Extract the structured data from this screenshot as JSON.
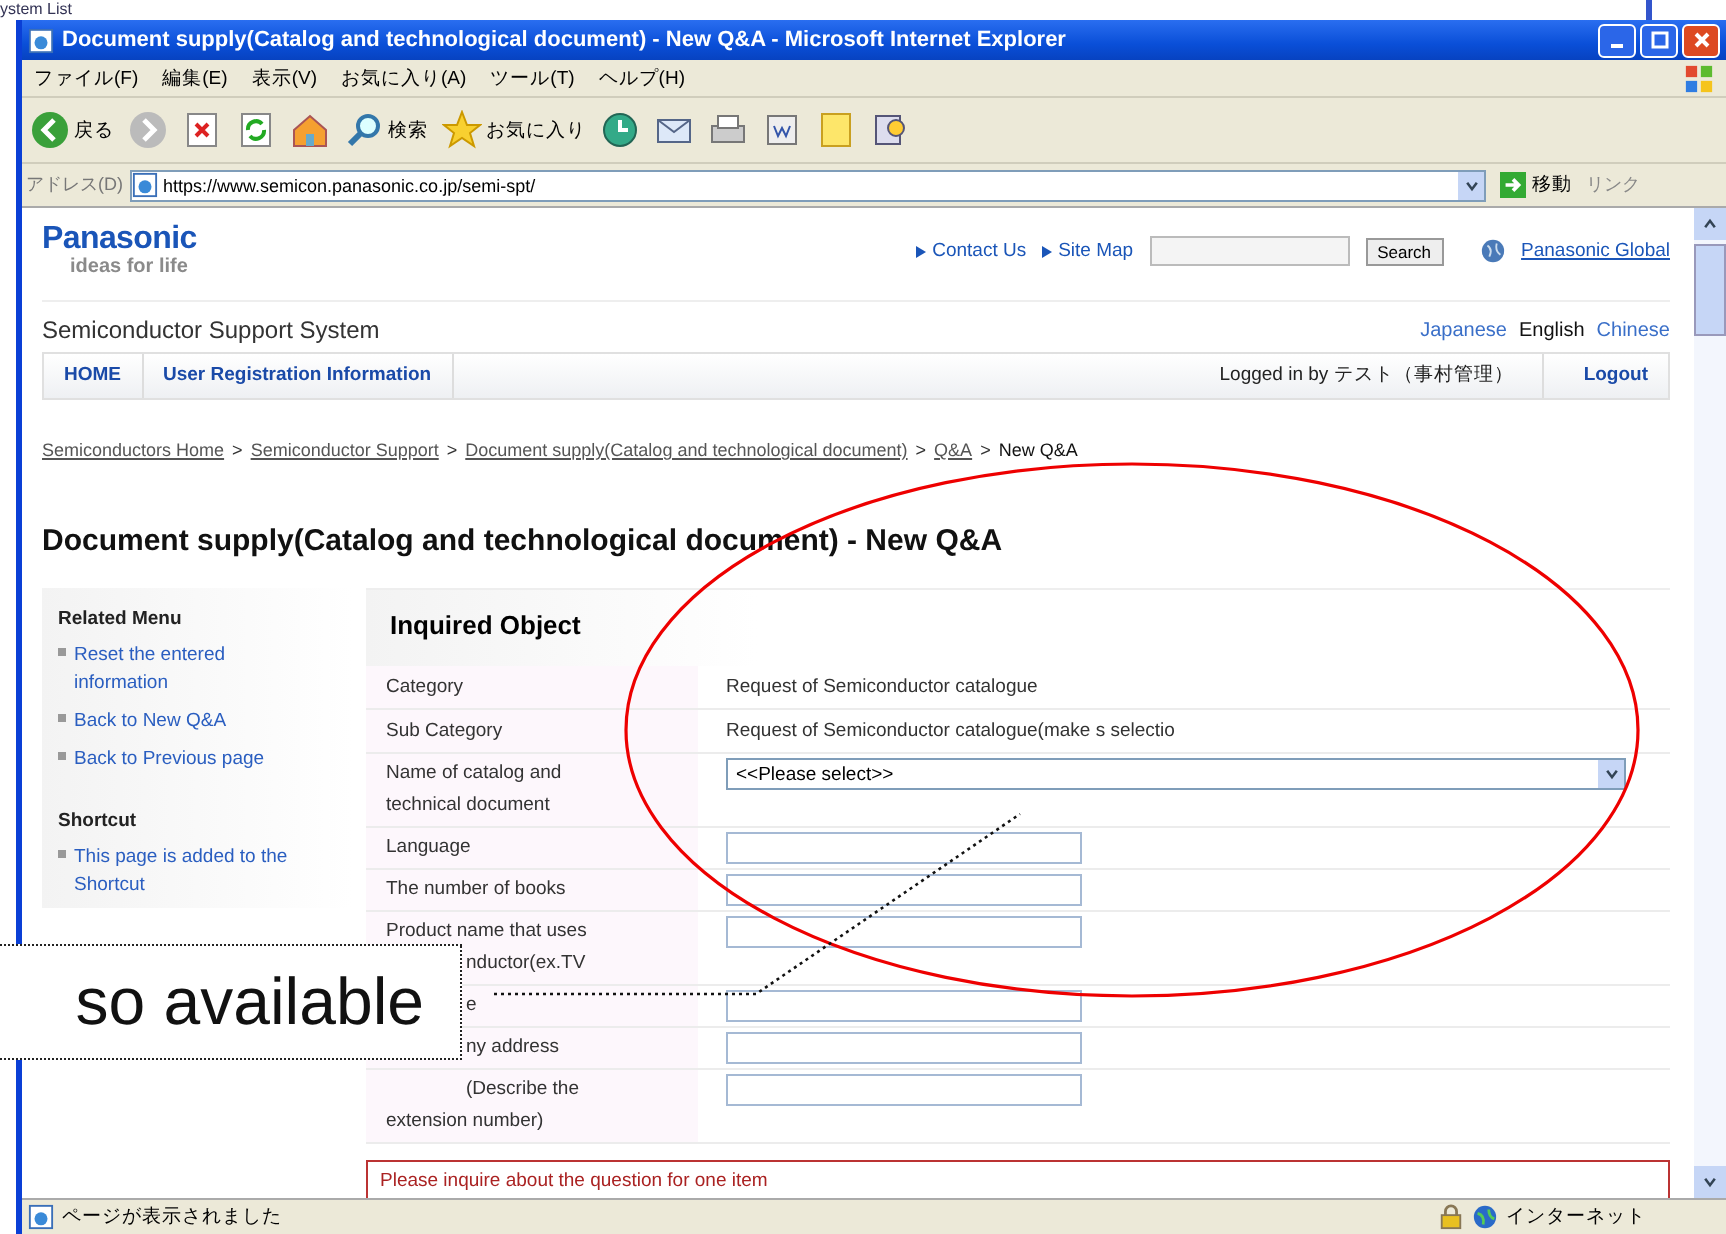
{
  "background_window": {
    "text": "ystem List"
  },
  "window": {
    "title": "Document supply(Catalog and technological document) - New Q&A - Microsoft Internet Explorer"
  },
  "menu_bar": [
    "ファイル(F)",
    "編集(E)",
    "表示(V)",
    "お気に入り(A)",
    "ツール(T)",
    "ヘルプ(H)"
  ],
  "toolbar": {
    "back": "戻る",
    "search": "検索",
    "favorites": "お気に入り"
  },
  "address_bar": {
    "label": "アドレス(D)",
    "url": "https://www.semicon.panasonic.co.jp/semi-spt/",
    "go": "移動",
    "links": "リンク"
  },
  "header": {
    "logo": "Panasonic",
    "tagline": "ideas for life",
    "links": [
      "Contact Us",
      "Site Map"
    ],
    "search_button": "Search",
    "global_link": "Panasonic Global"
  },
  "system": {
    "title": "Semiconductor Support System",
    "languages": [
      {
        "label": "Japanese",
        "selected": false
      },
      {
        "label": "English",
        "selected": true
      },
      {
        "label": "Chinese",
        "selected": false
      }
    ]
  },
  "nav": {
    "items": [
      "HOME",
      "User Registration Information"
    ],
    "logged_in": "Logged in by テスト（事村管理）",
    "logout": "Logout"
  },
  "breadcrumb_separator": ">",
  "breadcrumb": [
    {
      "label": "Semiconductors Home",
      "current": false
    },
    {
      "label": "Semiconductor Support",
      "current": false
    },
    {
      "label": "Document supply(Catalog and technological document)",
      "current": false
    },
    {
      "label": "Q&A",
      "current": false
    },
    {
      "label": "New Q&A",
      "current": true
    }
  ],
  "heading": "Document supply(Catalog and technological document) - New Q&A",
  "sidebar": [
    {
      "title": "Related Menu",
      "items": [
        "Reset the entered information",
        "Back to New Q&A",
        "Back to Previous page"
      ]
    },
    {
      "title": "Shortcut",
      "items": [
        "This page is added to the Shortcut"
      ]
    }
  ],
  "form": {
    "title": "Inquired Object",
    "rows": [
      {
        "label": [
          "Category"
        ],
        "kind": "text",
        "value": "Request of Semiconductor catalogue"
      },
      {
        "label": [
          "Sub Category"
        ],
        "kind": "text",
        "value": "Request of Semiconductor catalogue(make s selectio"
      },
      {
        "label": [
          "Name of catalog and",
          "technical document"
        ],
        "kind": "select",
        "value": "<<Please select>>"
      },
      {
        "label": [
          "Language"
        ],
        "kind": "input"
      },
      {
        "label": [
          "The number of books"
        ],
        "kind": "input"
      },
      {
        "label": [
          "Product name that uses",
          "nductor(ex.TV"
        ],
        "kind": "input",
        "covered": [
          false,
          true
        ]
      },
      {
        "label": [
          "e"
        ],
        "kind": "input",
        "covered": [
          true
        ]
      },
      {
        "label": [
          "ny address"
        ],
        "kind": "input",
        "covered": [
          true
        ]
      },
      {
        "label": [
          "(Describe the",
          "extension number)"
        ],
        "kind": "input",
        "covered": [
          true,
          false
        ]
      }
    ]
  },
  "notice": "Please inquire about the question for one item",
  "status_bar": {
    "text": "ページが表示されました",
    "zone": "インターネット"
  },
  "annotation": {
    "text": "so available"
  }
}
